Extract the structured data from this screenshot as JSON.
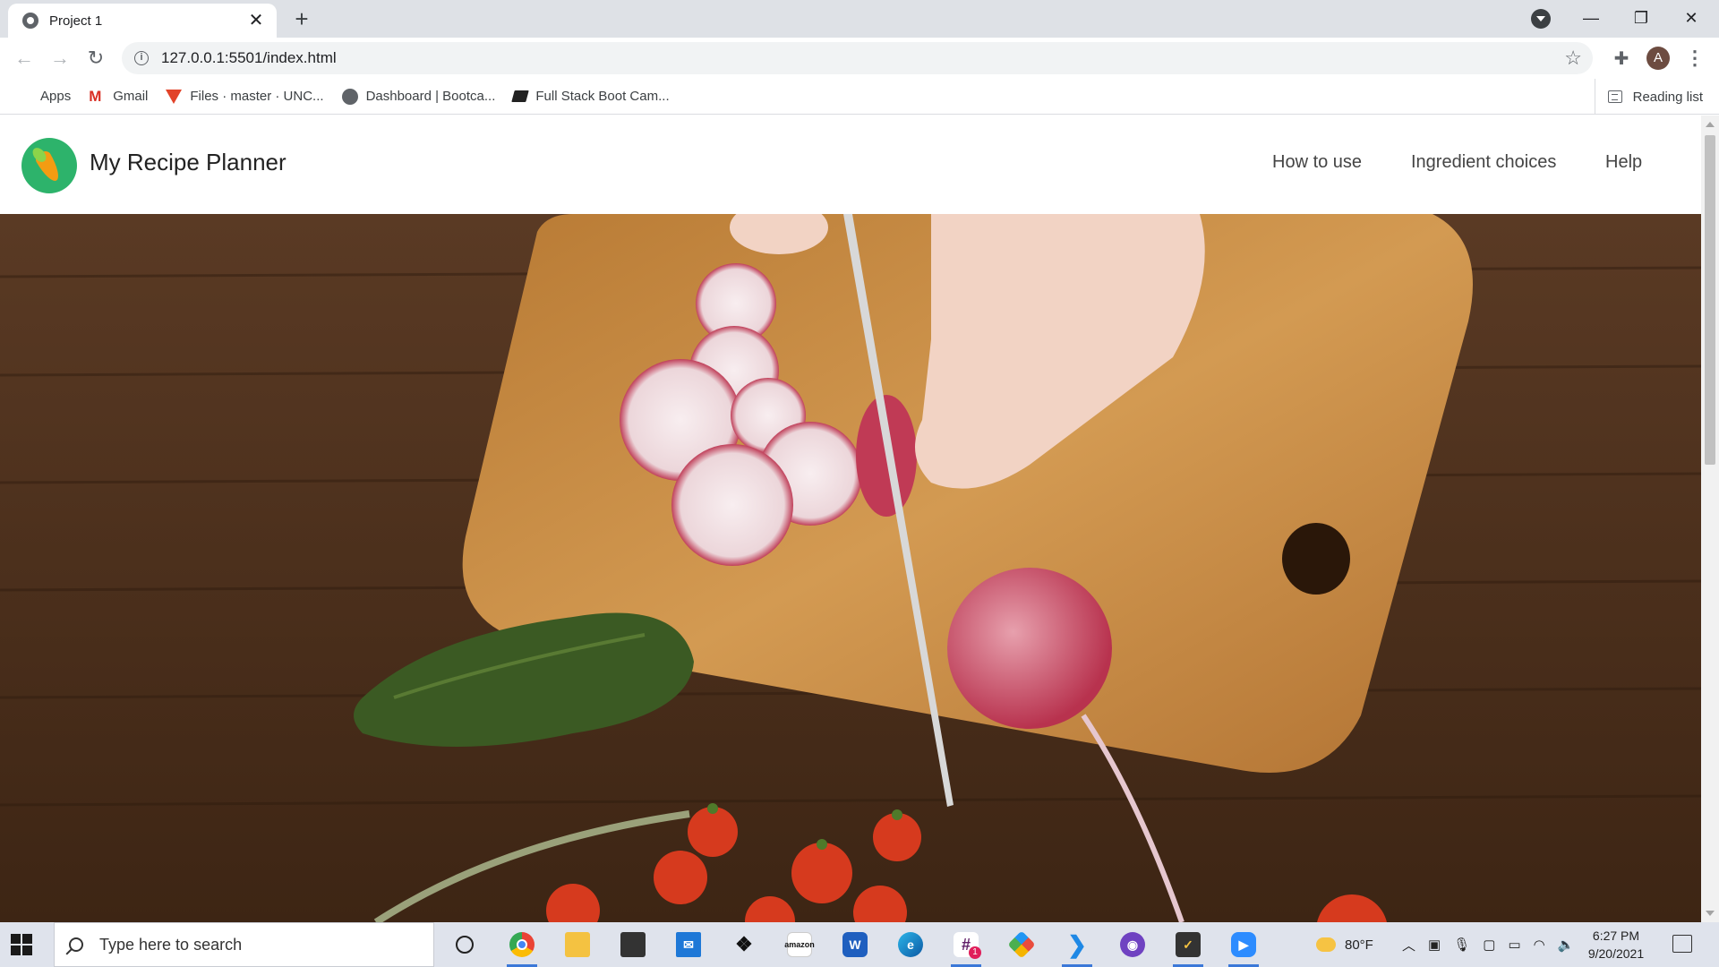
{
  "browser": {
    "tab_title": "Project 1",
    "tab_close": "✕",
    "new_tab": "+",
    "url": "127.0.0.1:5501/index.html",
    "profile_initial": "A",
    "window": {
      "minimize": "—",
      "maximize": "❐",
      "close": "✕"
    }
  },
  "bookmarks": {
    "items": [
      {
        "label": "Apps",
        "icon": "apps-grid-icon"
      },
      {
        "label": "Gmail",
        "icon": "gmail-icon"
      },
      {
        "label": "Files · master · UNC...",
        "icon": "gitlab-icon"
      },
      {
        "label": "Dashboard | Bootca...",
        "icon": "globe-icon"
      },
      {
        "label": "Full Stack Boot Cam...",
        "icon": "book-icon"
      }
    ],
    "reading_list": "Reading list"
  },
  "site": {
    "title": "My Recipe Planner",
    "nav": [
      "How to use",
      "Ingredient choices",
      "Help"
    ]
  },
  "taskbar": {
    "search_placeholder": "Type here to search",
    "weather": "80°F",
    "time": "6:27 PM",
    "date": "9/20/2021",
    "slack_badge": "1"
  },
  "colors": {
    "logo_green": "#2db36b",
    "hero_wood": "#4a2e1c",
    "board": "#c88a3e"
  }
}
